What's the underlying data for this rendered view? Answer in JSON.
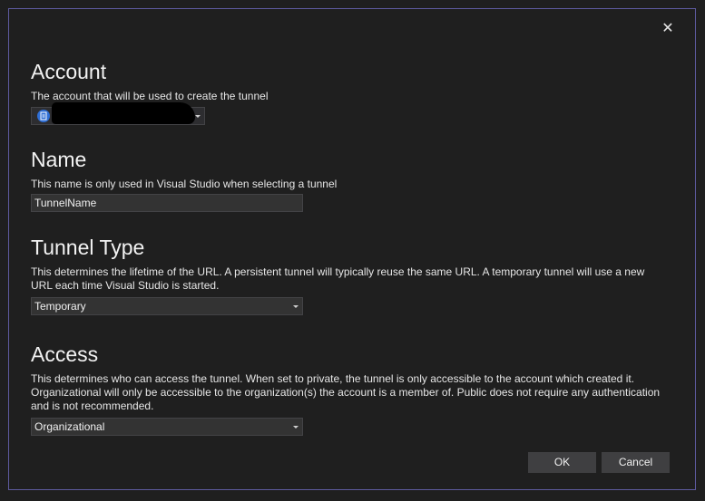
{
  "dialog": {
    "close_glyph": "✕"
  },
  "account": {
    "title": "Account",
    "description": "The account that will be used to create the tunnel",
    "selected": ""
  },
  "name": {
    "title": "Name",
    "description": "This name is only used in Visual Studio when selecting a tunnel",
    "value": "TunnelName"
  },
  "tunnel_type": {
    "title": "Tunnel Type",
    "description": "This determines the lifetime of the URL. A persistent tunnel will typically reuse the same URL. A temporary tunnel will use a new URL each time Visual Studio is started.",
    "selected": "Temporary"
  },
  "access": {
    "title": "Access",
    "description": "This determines who can access the tunnel. When set to private, the tunnel is only accessible to the account which created it. Organizational will only be accessible to the organization(s) the account is a member of. Public does not require any authentication and is not recommended.",
    "selected": "Organizational"
  },
  "buttons": {
    "ok": "OK",
    "cancel": "Cancel"
  },
  "colors": {
    "background": "#1f1f1f",
    "border_accent": "#5d5a9e",
    "field_bg": "#333333",
    "button_bg": "#3f3f41"
  }
}
